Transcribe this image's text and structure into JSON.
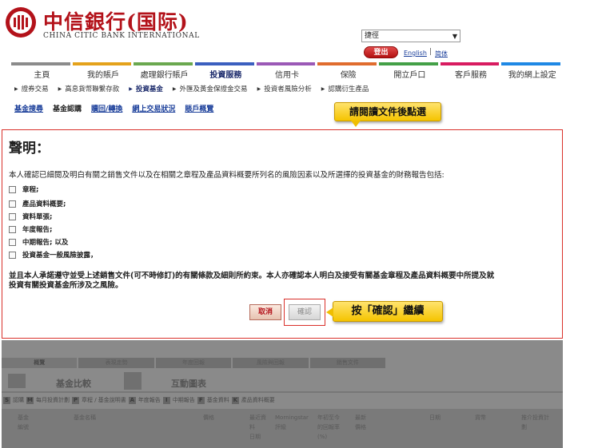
{
  "brand": {
    "name_cn": "中信銀行(国际)",
    "name_en": "CHINA CITIC BANK INTERNATIONAL",
    "color": "#b3121a"
  },
  "header": {
    "language_select": "捷徑",
    "logout_label": "登出",
    "english_link": "English",
    "separator": "|",
    "simplified_link": "简体"
  },
  "nav": {
    "items": [
      {
        "label": "主頁",
        "color": "#8b8b8b"
      },
      {
        "label": "我的賬戶",
        "color": "#e4a21b"
      },
      {
        "label": "處理銀行賬戶",
        "color": "#6aa84f"
      },
      {
        "label": "投資服務",
        "color": "#3b5fbf",
        "active": true
      },
      {
        "label": "信用卡",
        "color": "#9b59b6"
      },
      {
        "label": "保險",
        "color": "#e06c2e"
      },
      {
        "label": "開立戶口",
        "color": "#43a047"
      },
      {
        "label": "客戶服務",
        "color": "#d81b60"
      },
      {
        "label": "我的網上設定",
        "color": "#1e88e5"
      }
    ]
  },
  "subnav": {
    "items": [
      {
        "label": "證券交易"
      },
      {
        "label": "高息貨幣聯繫存款"
      },
      {
        "label": "投資基金",
        "active": true
      },
      {
        "label": "外匯及黃金保證金交易"
      },
      {
        "label": "投資者風險分析"
      },
      {
        "label": "認購衍生產品"
      }
    ]
  },
  "fund_tabs": {
    "items": [
      {
        "label": "基金搜尋"
      },
      {
        "label": "基金認購",
        "current": true
      },
      {
        "label": "贖回/轉換"
      },
      {
        "label": "網上交易狀況"
      },
      {
        "label": "賬戶概覽"
      }
    ]
  },
  "callouts": {
    "read_docs": "請閱讀文件後點選",
    "press_confirm": "按「確認」繼續"
  },
  "declaration": {
    "title": "聲明：",
    "intro": "本人確認已細閱及明白有關之銷售文件以及在相關之章程及產品資料概要所列名的風險因素以及所選擇的投資基金的財務報告包括:",
    "items": [
      "章程;",
      "產品資料概要;",
      "資料單張;",
      "年度報告;",
      "中期報告; 以及",
      "投資基金一般風險披露，"
    ],
    "footer_line1": "並且本人承諾遵守並受上述銷售文件(可不時修訂)的有關條款及細則所約束。本人亦確認本人明白及接受有關基金章程及產品資料概要中所提及就",
    "footer_line2": "投資有關投資基金所涉及之風險。",
    "cancel_label": "取消",
    "confirm_label": "確認"
  },
  "background_page": {
    "tabs": [
      "概覽",
      "表現走勢",
      "年度回報",
      "風險與回報",
      "銷售文件"
    ],
    "fund_compare": "基金比較",
    "interactive_chart": "互動圖表",
    "legend": "認購 ■ 每月投資計劃 P 章程 / 基金說明書 A 年度報告 I 中期報告 F 基金資料 K 產品資料概要",
    "legend_parts": [
      {
        "badge": "S",
        "text": "認購"
      },
      {
        "badge": "M",
        "text": "每月投資計劃"
      },
      {
        "badge": "P",
        "text": "章程 / 基金說明書"
      },
      {
        "badge": "A",
        "text": "年度報告"
      },
      {
        "badge": "I",
        "text": "中期報告"
      },
      {
        "badge": "F",
        "text": "基金資料"
      },
      {
        "badge": "K",
        "text": "產品資料概要"
      }
    ],
    "table_headers": [
      "基金\n編號",
      "基金名稱",
      "價格",
      "最近資\n料\n日期",
      "Morningstar\n評級",
      "年初至今\n的回報率\n(%)",
      "最新\n價格",
      "日期",
      "貨幣",
      "推介投資計\n劃"
    ]
  }
}
